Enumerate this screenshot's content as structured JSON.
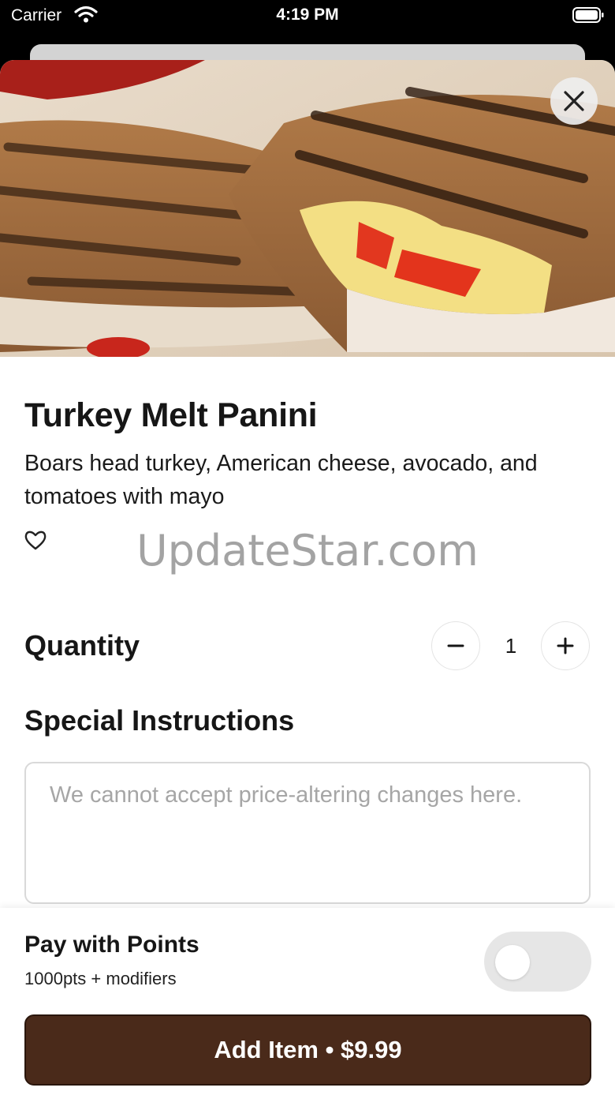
{
  "status_bar": {
    "carrier": "Carrier",
    "time": "4:19 PM"
  },
  "item": {
    "title": "Turkey Melt Panini",
    "description": "Boars head turkey, American cheese, avocado, and tomatoes with mayo",
    "image": "panini-photo"
  },
  "watermark": "UpdateStar.com",
  "quantity": {
    "label": "Quantity",
    "value": "1",
    "minus_icon": "minus-icon",
    "plus_icon": "plus-icon"
  },
  "instructions": {
    "label": "Special Instructions",
    "placeholder": "We cannot accept price-altering changes here.",
    "value": ""
  },
  "points": {
    "title": "Pay with Points",
    "subtitle": "1000pts + modifiers",
    "enabled": false
  },
  "add_button": {
    "label": "Add Item • $9.99"
  },
  "colors": {
    "primary": "#4a2a1a",
    "toggle_off": "#e6e6e6"
  }
}
